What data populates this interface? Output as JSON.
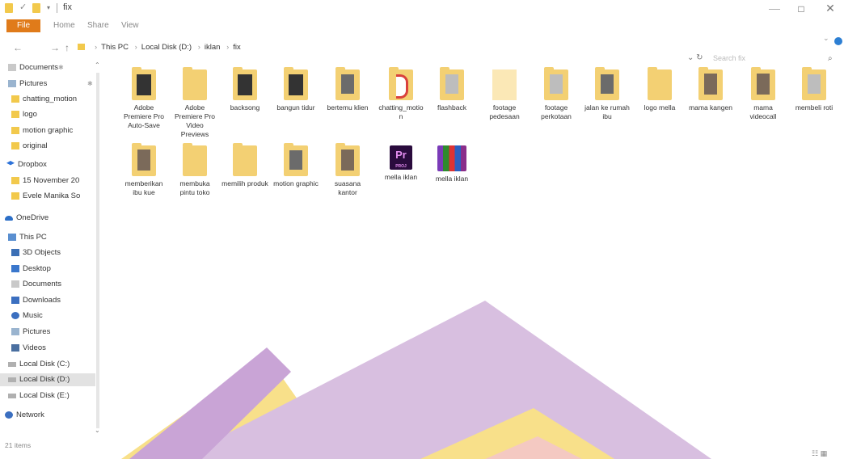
{
  "window": {
    "title": "fix",
    "min_glyph": "—",
    "max_glyph": "□",
    "close_glyph": "✕"
  },
  "ribbon": {
    "tabs": [
      "File",
      "Home",
      "Share",
      "View"
    ]
  },
  "address": {
    "back": "←",
    "forward": "→",
    "up": "↑",
    "crumbs": [
      "This PC",
      "Local Disk (D:)",
      "iklan",
      "fix"
    ],
    "search_placeholder": "Search fix"
  },
  "sidebar": {
    "items": [
      {
        "label": "Documents",
        "icon": "document-icon"
      },
      {
        "label": "Pictures",
        "icon": "pictures-icon"
      },
      {
        "label": "chatting_motion",
        "icon": "folder-icon"
      },
      {
        "label": "logo",
        "icon": "folder-icon"
      },
      {
        "label": "motion graphic",
        "icon": "folder-icon"
      },
      {
        "label": "original",
        "icon": "folder-icon"
      },
      {
        "label": "Dropbox",
        "icon": "dropbox-icon"
      },
      {
        "label": "15 November 20",
        "icon": "folder-icon"
      },
      {
        "label": "Evele Manika So",
        "icon": "folder-icon"
      },
      {
        "label": "OneDrive",
        "icon": "onedrive-icon"
      },
      {
        "label": "This PC",
        "icon": "this-pc-icon"
      },
      {
        "label": "3D Objects",
        "icon": "3d-objects-icon"
      },
      {
        "label": "Desktop",
        "icon": "desktop-icon"
      },
      {
        "label": "Documents",
        "icon": "document-icon"
      },
      {
        "label": "Downloads",
        "icon": "downloads-icon"
      },
      {
        "label": "Music",
        "icon": "music-icon"
      },
      {
        "label": "Pictures",
        "icon": "pictures-icon"
      },
      {
        "label": "Videos",
        "icon": "videos-icon"
      },
      {
        "label": "Local Disk (C:)",
        "icon": "disk-icon"
      },
      {
        "label": "Local Disk (D:)",
        "icon": "disk-icon"
      },
      {
        "label": "Local Disk (E:)",
        "icon": "disk-icon"
      },
      {
        "label": "Network",
        "icon": "network-icon"
      }
    ]
  },
  "files": [
    {
      "name": "Adobe Premiere Pro Auto-Save",
      "kind": "folder-dark"
    },
    {
      "name": "Adobe Premiere Pro Video Previews",
      "kind": "folder"
    },
    {
      "name": "backsong",
      "kind": "folder-dark"
    },
    {
      "name": "bangun tidur",
      "kind": "folder-dark"
    },
    {
      "name": "bertemu klien",
      "kind": "folder-img"
    },
    {
      "name": "chatting_motion",
      "kind": "folder-red"
    },
    {
      "name": "flashback",
      "kind": "folder-grey"
    },
    {
      "name": "footage pedesaan",
      "kind": "blank"
    },
    {
      "name": "footage perkotaan",
      "kind": "folder-grey"
    },
    {
      "name": "jalan ke rumah ibu",
      "kind": "folder-img"
    },
    {
      "name": "logo mella",
      "kind": "folder"
    },
    {
      "name": "mama kangen",
      "kind": "folder-pic"
    },
    {
      "name": "mama videocall",
      "kind": "folder-pic"
    },
    {
      "name": "membeli roti",
      "kind": "folder-grey"
    },
    {
      "name": "memberikan ibu kue",
      "kind": "folder-pic"
    },
    {
      "name": "membuka pintu toko",
      "kind": "folder"
    },
    {
      "name": "memilih produk",
      "kind": "folder"
    },
    {
      "name": "motion graphic",
      "kind": "folder-img"
    },
    {
      "name": "suasana kantor",
      "kind": "folder-pic"
    },
    {
      "name": "mella iklan",
      "kind": "premiere-project"
    },
    {
      "name": "mella iklan",
      "kind": "rar-archive"
    }
  ],
  "premiere_badge": {
    "main": "Pr",
    "sub": "PROJ"
  },
  "status": {
    "item_count": "21 items"
  },
  "colors": {
    "file_tab": "#e07b1a",
    "folder": "#f3d073",
    "watermark_purple": "#c9a4d6",
    "watermark_yellow": "#f8e08a",
    "watermark_pink": "#f4c9c2"
  }
}
